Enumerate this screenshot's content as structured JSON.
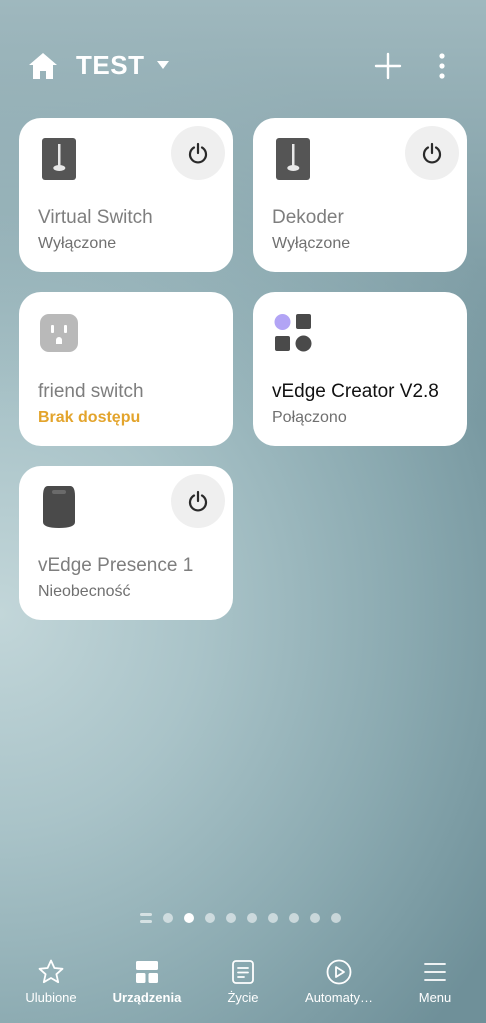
{
  "header": {
    "title": "TEST",
    "home_icon": "home-icon",
    "caret_icon": "caret-down-icon",
    "add_icon": "plus-icon",
    "more_icon": "more-vertical-icon"
  },
  "devices": [
    {
      "name": "Virtual Switch",
      "status": "Wyłączone",
      "icon": "switch-icon",
      "has_power": true
    },
    {
      "name": "Dekoder",
      "status": "Wyłączone",
      "icon": "switch-icon",
      "has_power": true
    },
    {
      "name": "friend switch",
      "status": "Brak dostępu",
      "icon": "outlet-icon",
      "has_power": false
    },
    {
      "name": "vEdge Creator V2.8",
      "status": "Połączono",
      "icon": "apps-icon",
      "has_power": false
    },
    {
      "name": "vEdge Presence 1",
      "status": "Nieobecność",
      "icon": "presence-sensor-icon",
      "has_power": true
    }
  ],
  "pager": {
    "pages": 9,
    "current": 2
  },
  "nav": {
    "items": [
      {
        "label": "Ulubione",
        "icon": "star-icon",
        "active": false
      },
      {
        "label": "Urządzenia",
        "icon": "devices-grid-icon",
        "active": true
      },
      {
        "label": "Życie",
        "icon": "life-icon",
        "active": false
      },
      {
        "label": "Automaty…",
        "icon": "play-circle-icon",
        "active": false
      },
      {
        "label": "Menu",
        "icon": "menu-icon",
        "active": false
      }
    ]
  },
  "colors": {
    "warning": "#e3a42c",
    "card": "#ffffff",
    "accent_purple": "#b2a4f5"
  }
}
